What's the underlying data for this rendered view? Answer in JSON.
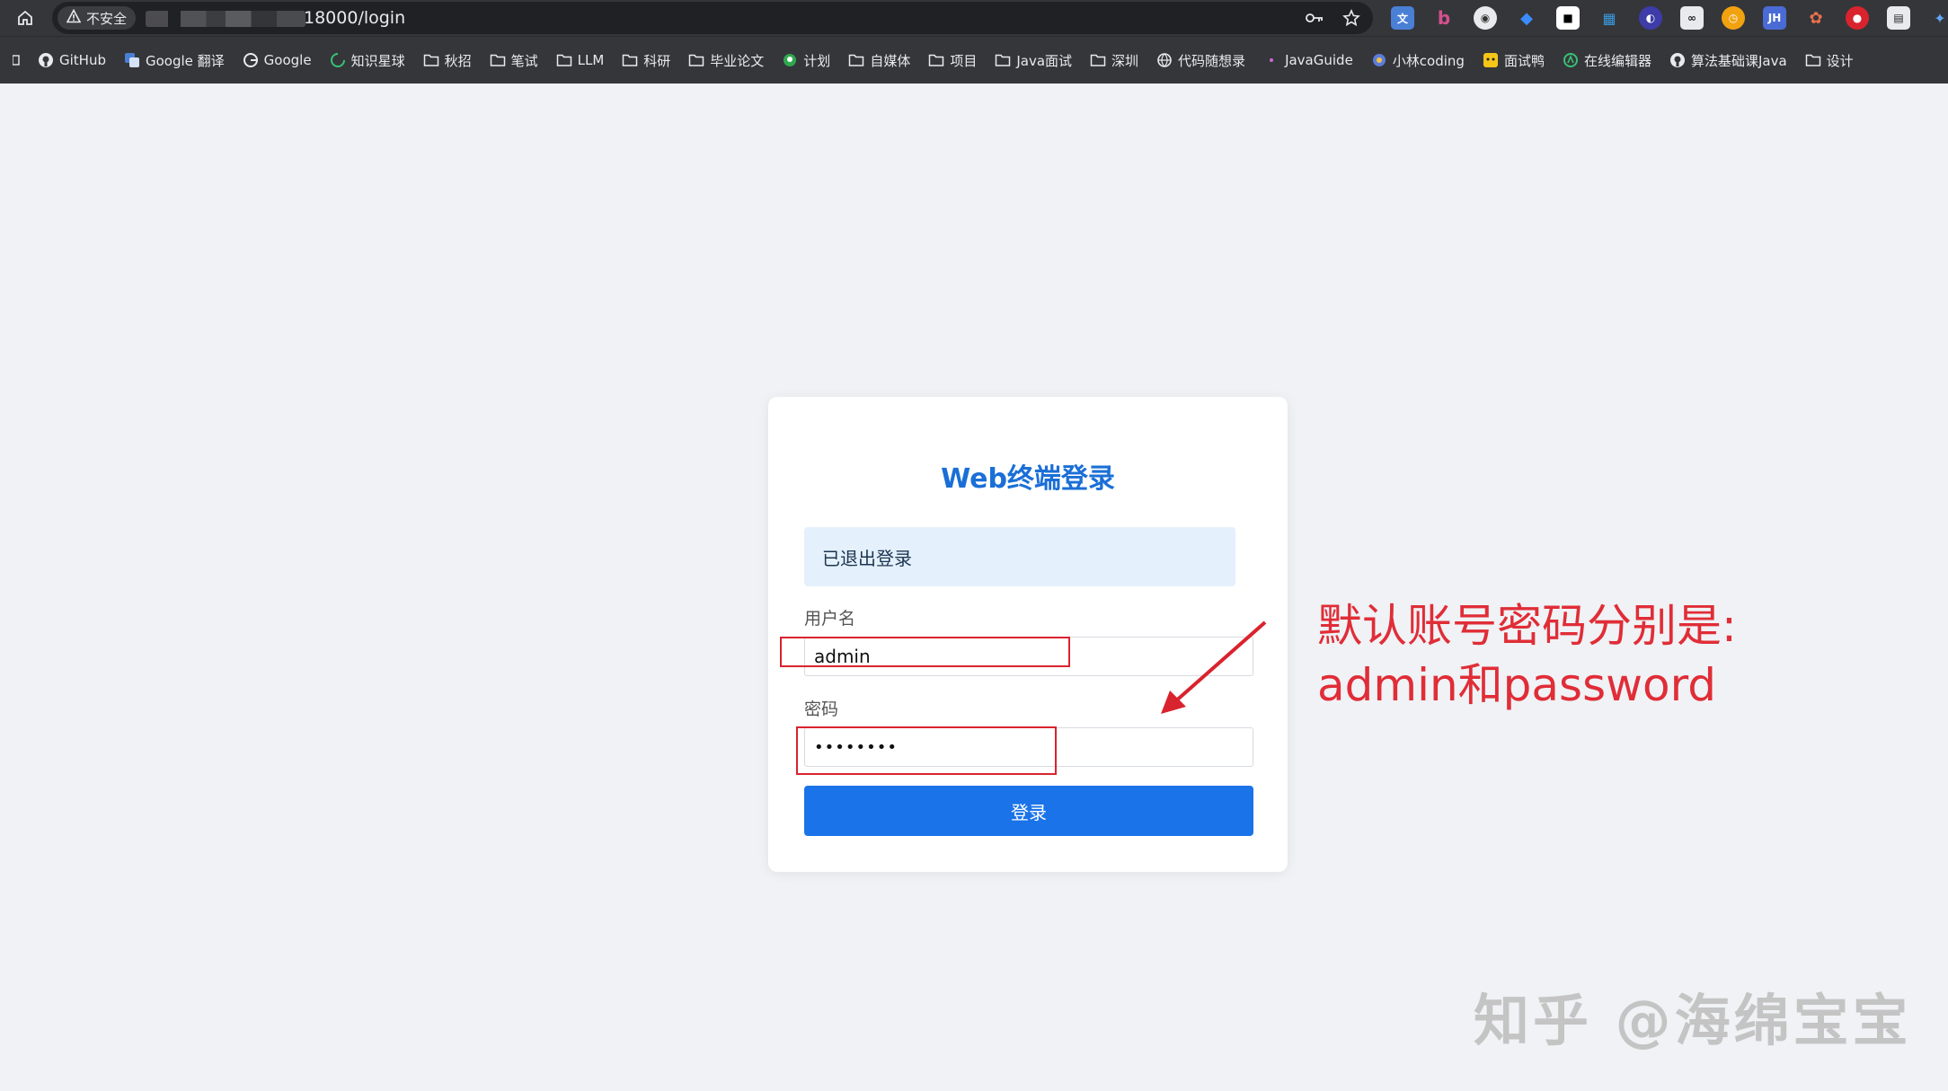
{
  "browser": {
    "security_label": "不安全",
    "url_visible": "18000/login",
    "bookmarks": [
      {
        "label": "GitHub",
        "icon": "github-icon"
      },
      {
        "label": "Google 翻译",
        "icon": "translate-icon"
      },
      {
        "label": "Google",
        "icon": "google-icon"
      },
      {
        "label": "知识星球",
        "icon": "planet-icon"
      },
      {
        "label": "秋招",
        "icon": "folder-icon"
      },
      {
        "label": "笔试",
        "icon": "folder-icon"
      },
      {
        "label": "LLM",
        "icon": "folder-icon"
      },
      {
        "label": "科研",
        "icon": "folder-icon"
      },
      {
        "label": "毕业论文",
        "icon": "folder-icon"
      },
      {
        "label": "计划",
        "icon": "green-dot-icon"
      },
      {
        "label": "自媒体",
        "icon": "folder-icon"
      },
      {
        "label": "项目",
        "icon": "folder-icon"
      },
      {
        "label": "Java面试",
        "icon": "folder-icon"
      },
      {
        "label": "深圳",
        "icon": "folder-icon"
      },
      {
        "label": "代码随想录",
        "icon": "globe-icon"
      },
      {
        "label": "JavaGuide",
        "icon": "dot-icon"
      },
      {
        "label": "小林coding",
        "icon": "site-icon"
      },
      {
        "label": "面试鸭",
        "icon": "duck-icon"
      },
      {
        "label": "在线编辑器",
        "icon": "editor-icon"
      },
      {
        "label": "算法基础课Java",
        "icon": "github-icon"
      },
      {
        "label": "设计",
        "icon": "folder-icon"
      }
    ]
  },
  "login": {
    "title": "Web终端登录",
    "alert": "已退出登录",
    "username_label": "用户名",
    "username_value": "admin",
    "password_label": "密码",
    "password_value": "password",
    "submit_label": "登录"
  },
  "annotation": {
    "line1": "默认账号密码分别是:",
    "line2": "admin和password",
    "color": "#e02d37"
  },
  "watermark": "知乎 @海绵宝宝",
  "colors": {
    "accent": "#1a73e8",
    "title": "#1a6fd6",
    "alert_bg": "#e4f0fc",
    "page_bg": "#f0f2f5"
  }
}
